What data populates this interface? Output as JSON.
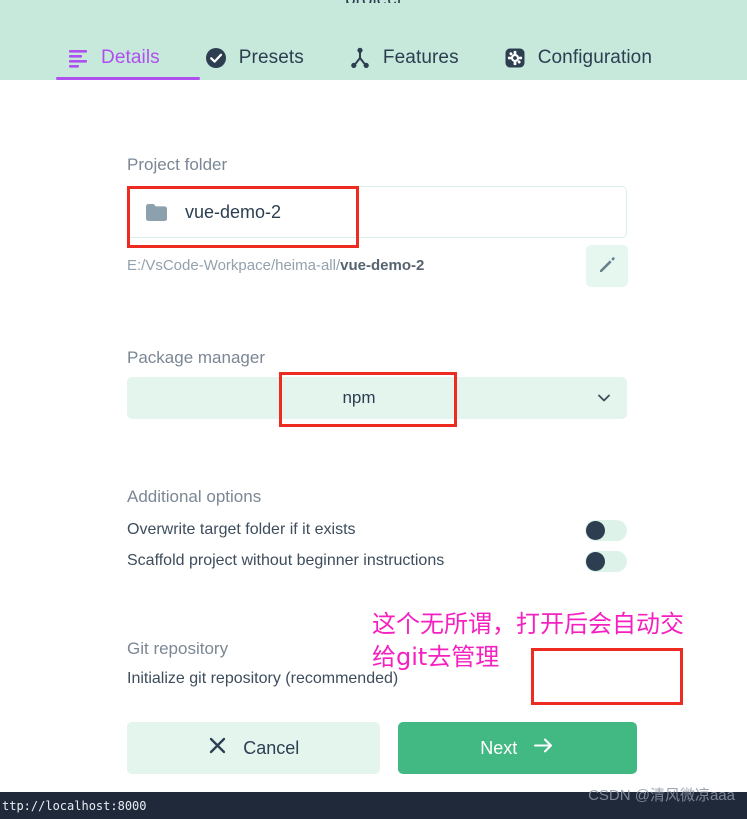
{
  "window": {
    "title_partial": "project"
  },
  "tabs": [
    {
      "label": "Details",
      "icon": "list-lines-icon",
      "active": true
    },
    {
      "label": "Presets",
      "icon": "check-circle-icon",
      "active": false
    },
    {
      "label": "Features",
      "icon": "node-tree-icon",
      "active": false
    },
    {
      "label": "Configuration",
      "icon": "gear-square-icon",
      "active": false
    }
  ],
  "project_folder": {
    "label": "Project folder",
    "value": "vue-demo-2",
    "folder_icon": "folder-icon",
    "path_prefix": "E:/VsCode-Workpace/heima-all/",
    "path_name": "vue-demo-2",
    "edit_icon": "pencil-icon"
  },
  "package_manager": {
    "label": "Package manager",
    "value": "npm",
    "chevron_icon": "chevron-down-icon"
  },
  "additional_options": {
    "label": "Additional options",
    "items": [
      {
        "label": "Overwrite target folder if it exists",
        "on": false
      },
      {
        "label": "Scaffold project without beginner instructions",
        "on": false
      }
    ]
  },
  "git_repository": {
    "label": "Git repository",
    "option_label": "Initialize git repository (recommended)",
    "on": true
  },
  "footer": {
    "cancel_label": "Cancel",
    "cancel_icon": "close-x-icon",
    "next_label": "Next",
    "next_icon": "arrow-right-icon"
  },
  "annotations": {
    "note_text": "这个无所谓，打开后会自动交\n给git去管理",
    "note_color": "#f520c0",
    "box_color": "#ee2b20"
  },
  "statusbar": {
    "url": "ttp://localhost:8000",
    "watermark": "CSDN @清风微凉aaa"
  },
  "colors": {
    "header_bg": "#c6e9dc",
    "accent_purple": "#b04ff0",
    "vue_green": "#42b983",
    "pale_green": "#e3f5ec",
    "dark_navy": "#2c3e50"
  }
}
